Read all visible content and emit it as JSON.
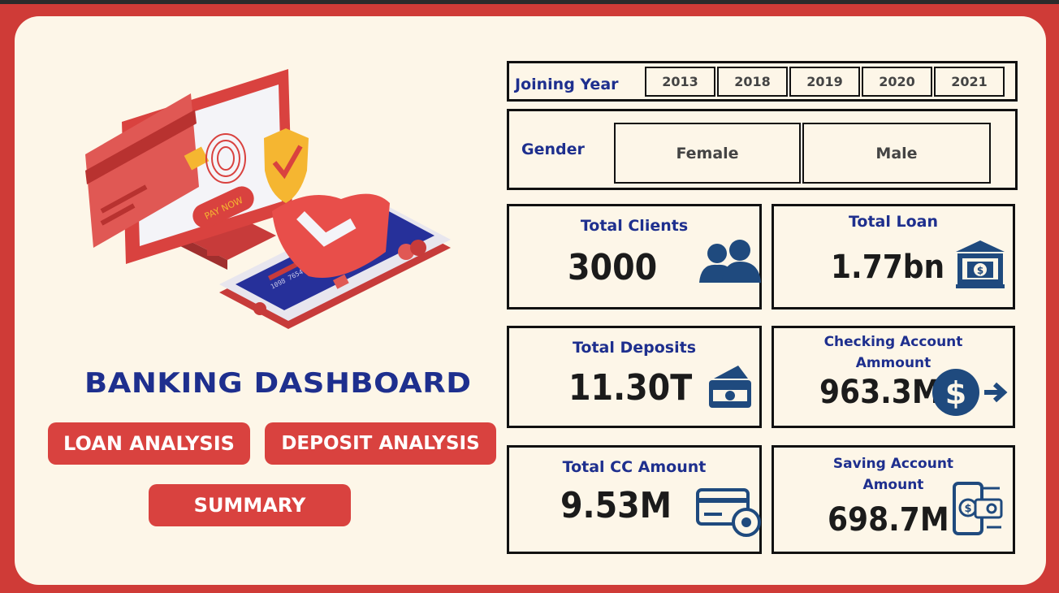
{
  "colors": {
    "brand_red": "#cf3b37",
    "panel_bg": "#fdf6e8",
    "navy": "#1e2f8e",
    "icon_navy": "#1f4a7e"
  },
  "dashboard": {
    "title": "BANKING DASHBOARD"
  },
  "nav": {
    "loan_analysis": "LOAN ANALYSIS",
    "deposit_analysis": "DEPOSIT ANALYSIS",
    "summary": "SUMMARY"
  },
  "illustration": {
    "pay_now": "PAY NOW",
    "card_number": "1098 7654 3210"
  },
  "filters": {
    "joining_year": {
      "label": "Joining Year",
      "options": [
        "2013",
        "2018",
        "2019",
        "2020",
        "2021"
      ]
    },
    "gender": {
      "label": "Gender",
      "options": [
        "Female",
        "Male"
      ]
    }
  },
  "kpis": {
    "total_clients": {
      "label": "Total Clients",
      "value": "3000",
      "icon": "people-icon"
    },
    "total_loan": {
      "label": "Total Loan",
      "value": "1.77bn",
      "icon": "bank-icon"
    },
    "total_deposits": {
      "label": "Total Deposits",
      "value": "11.30T",
      "icon": "cash-icon"
    },
    "checking_account": {
      "label_line1": "Checking Account",
      "label_line2": "Ammount",
      "value": "963.3M",
      "icon": "dollar-transfer-icon"
    },
    "total_cc": {
      "label": "Total CC Amount",
      "value": "9.53M",
      "icon": "credit-card-settings-icon"
    },
    "saving_account": {
      "label_line1": "Saving Account",
      "label_line2": "Amount",
      "value": "698.7M",
      "icon": "mobile-payment-icon"
    }
  }
}
